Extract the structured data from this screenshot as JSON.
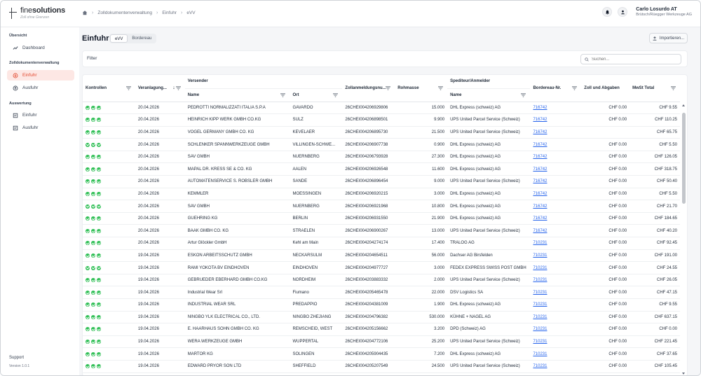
{
  "app": {
    "brand_light": "fine",
    "brand_bold": "solutions",
    "tagline": "Zoll ohne Grenzen"
  },
  "breadcrumb": [
    "Zolldokumentenverwaltung",
    "Einfuhr",
    "eVV"
  ],
  "user": {
    "name": "Carlo Losurdo AT",
    "company": "Brütsch/Rüegger Werkzeuge AG"
  },
  "sidebar": {
    "sections": [
      {
        "title": "Übersicht",
        "items": [
          {
            "label": "Dashboard",
            "icon": "chart-line-icon",
            "active": false
          }
        ]
      },
      {
        "title": "Zolldokumentenverwaltung",
        "items": [
          {
            "label": "Einfuhr",
            "icon": "import-icon",
            "active": true
          },
          {
            "label": "Ausfuhr",
            "icon": "export-icon",
            "active": false
          }
        ]
      },
      {
        "title": "Auswertung",
        "items": [
          {
            "label": "Einfuhr",
            "icon": "report-icon",
            "active": false
          },
          {
            "label": "Ausfuhr",
            "icon": "report-icon",
            "active": false
          }
        ]
      }
    ],
    "support": "Support",
    "version": "Version 1.0.1"
  },
  "page": {
    "title": "Einfuhr",
    "tabs": [
      "eVV",
      "Bordereau"
    ],
    "active_tab": "eVV",
    "import_label": "Importieren..."
  },
  "filter": {
    "label": "Filter",
    "search_placeholder": "Suchen..."
  },
  "table": {
    "group_headers": {
      "versender": "Versender",
      "spediteur": "Spediteur/Anmelder"
    },
    "columns": {
      "kontrollen": "Kontrollen",
      "veranlagung": "Veranlagung...",
      "name": "Name",
      "ort": "Ort",
      "zollanmeldung": "Zollanmeldungsnu...",
      "rohmasse": "Rohmasse",
      "sped_name": "Name",
      "bordereau": "Bordereau-Nr.",
      "zoll": "Zoll und Abgaben",
      "mwst": "MwSt Total"
    },
    "rows": [
      [
        "20.04.2026",
        "PEDROTTI NORMALIZZATI ITALIA S.P.A",
        "GAVARDO",
        "26CHEI004206929806",
        "15.000",
        "DHL Express (schweiz) AG",
        "716742",
        "CHF 0.00",
        "CHF 9.55"
      ],
      [
        "20.04.2026",
        "HEINRICH KIPP WERK GMBH CO.KG",
        "SULZ",
        "26CHEI004206898501",
        "9.900",
        "UPS United Parcel Service (Schweiz)",
        "716742",
        "CHF 0.00",
        "CHF 110.25"
      ],
      [
        "20.04.2026",
        "VOGEL GERMANY GMBH CO. KG",
        "KEVELAER",
        "26CHEI004206895730",
        "21.500",
        "UPS United Parcel Service (Schweiz)",
        "716742",
        "",
        "CHF 65.75"
      ],
      [
        "20.04.2026",
        "SCHLENKER SPANNWERKZEUGE GMBH",
        "VILLINGEN-SCHWE...",
        "26CHEI004206907738",
        "0.900",
        "DHL Express (schweiz) AG",
        "716742",
        "CHF 0.00",
        "CHF 5.50"
      ],
      [
        "20.04.2026",
        "SAV GMBH",
        "NUERNBERG",
        "26CHEI004206793928",
        "27.300",
        "DHL Express (schweiz) AG",
        "716742",
        "CHF 0.00",
        "CHF 126.05"
      ],
      [
        "20.04.2026",
        "MAPAL DR. KRESS SE & CO. KG",
        "AALEN",
        "26CHEI004206926548",
        "11.600",
        "DHL Express (schweiz) AG",
        "716742",
        "CHF 0.00",
        "CHF 318.75"
      ],
      [
        "20.04.2026",
        "AUTOMATENSERVICE S. ROBSLER GMBH",
        "SANDE",
        "26CHEI004206896454",
        "9.000",
        "UPS United Parcel Service (Schweiz)",
        "716742",
        "CHF 0.00",
        "CHF 50.40"
      ],
      [
        "20.04.2026",
        "KEMMLER",
        "MOESSINGEN",
        "26CHEI004206920215",
        "3.000",
        "DHL Express (schweiz) AG",
        "716742",
        "CHF 0.00",
        "CHF 5.50"
      ],
      [
        "20.04.2026",
        "SAV GMBH",
        "NUERNBERG",
        "26CHEI004206921968",
        "10.800",
        "DHL Express (schweiz) AG",
        "716742",
        "CHF 0.00",
        "CHF 21.70"
      ],
      [
        "20.04.2026",
        "GUEHRING KG",
        "BERLIN",
        "26CHEI004206931550",
        "21.900",
        "DHL Express (schweiz) AG",
        "716742",
        "CHF 0.00",
        "CHF 184.65"
      ],
      [
        "20.04.2026",
        "BAAK GMBH CO. KG",
        "STRAELEN",
        "26CHEI004206900267",
        "13.000",
        "UPS United Parcel Service (Schweiz)",
        "716742",
        "CHF 0.00",
        "CHF 40.20"
      ],
      [
        "20.04.2026",
        "Artur Glöckler GmbH",
        "Kehl am Main",
        "26CHEI004204274174",
        "17.400",
        "TRALOG AG",
        "710231",
        "CHF 0.00",
        "CHF 92.45"
      ],
      [
        "19.04.2026",
        "ESKON ARBEITSSCHUTZ GMBH",
        "NECKARSULM",
        "26CHEI004204654511",
        "56.000",
        "Dachser AG Birsfelden",
        "710231",
        "CHF 0.00",
        "CHF 191.00"
      ],
      [
        "19.04.2026",
        "RAMI YOKOTA BV EINDHOVEN",
        "EINDHOVEN",
        "26CHEI004204977727",
        "3.000",
        "FEDEX EXPRESS SWISS POST GMBH",
        "710231",
        "CHF 0.00",
        "CHF 24.55"
      ],
      [
        "19.04.2026",
        "GEBRUEDER EBERHARD GMBH CO.KG",
        "NORDHEIM",
        "26CHEI004203883332",
        "2.000",
        "UPS United Parcel Service (Schweiz)",
        "710231",
        "CHF 0.00",
        "CHF 26.05"
      ],
      [
        "19.04.2026",
        "Industrial Wear Srl",
        "Fiumano",
        "26CHEI004205465478",
        "22.000",
        "DSV Logistics SA",
        "710231",
        "CHF 0.00",
        "CHF 47.15"
      ],
      [
        "19.04.2026",
        "INDUSTRIAL WEAR SRL",
        "PREDAPPIO",
        "26CHEI004204381009",
        "1.900",
        "DHL Express (schweiz) AG",
        "710231",
        "CHF 0.00",
        "CHF 9.55"
      ],
      [
        "19.04.2026",
        "NINGBO YLK ELECTRICAL CO., LTD.",
        "NINGBO ZHEJIANG",
        "26CHEI004204796382",
        "530.000",
        "KÜHNE + NAGEL AG",
        "710231",
        "CHF 0.00",
        "CHF 637.15"
      ],
      [
        "19.04.2026",
        "E. HAARHAUS SOHN GMBH CO. KG",
        "REMSCHEID, WEST",
        "26CHEI004205156662",
        "3.200",
        "DPD (Schweiz) AG",
        "710231",
        "CHF 0.00",
        "CHF 0.00"
      ],
      [
        "19.04.2026",
        "WERA WERKZEUGE GMBH",
        "WUPPERTAL",
        "26CHEI004204772106",
        "25.200",
        "UPS United Parcel Service (Schweiz)",
        "710231",
        "CHF 0.00",
        "CHF 221.45"
      ],
      [
        "19.04.2026",
        "MARTOR KG",
        "SOLINGEN",
        "26CHEI004205904435",
        "7.200",
        "DHL Express (schweiz) AG",
        "710231",
        "CHF 0.00",
        "CHF 37.65"
      ],
      [
        "19.04.2026",
        "EDWARD PRYOR SON LTD",
        "SHEFFIELD",
        "26CHEI004205207549",
        "24.500",
        "UPS United Parcel Service (Schweiz)",
        "710231",
        "CHF 0.00",
        "CHF 105.45"
      ]
    ]
  },
  "colors": {
    "accent": "#e2492f",
    "accent_bg": "#fde7e4",
    "check_green": "#2fbf55",
    "link": "#2563eb"
  }
}
